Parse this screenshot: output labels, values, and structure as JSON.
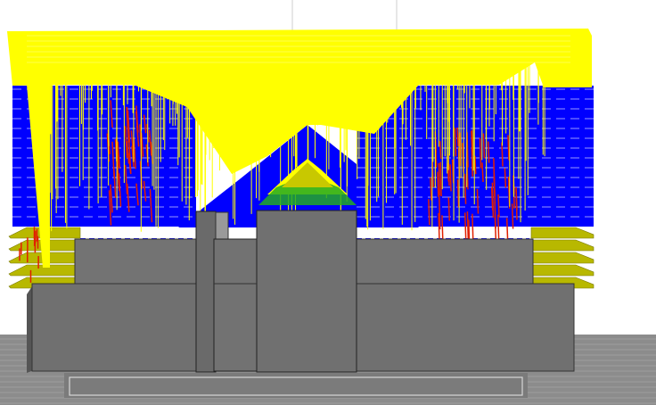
{
  "viewport": {
    "background": "#ffffff",
    "colors": {
      "travel_moves": "#ffff00",
      "infill_fast": "#0000ff",
      "support_infill": "#e02000",
      "perimeter_green": "#22aa22",
      "skirt_olive": "#b8b800",
      "model_face": "#707070",
      "model_top": "#9a9a9a",
      "build_plate": "#8c8c8c",
      "plate_grid": "#c8c8c8"
    },
    "layers": {
      "visible_solid_body": true,
      "gcode_preview": true
    }
  }
}
